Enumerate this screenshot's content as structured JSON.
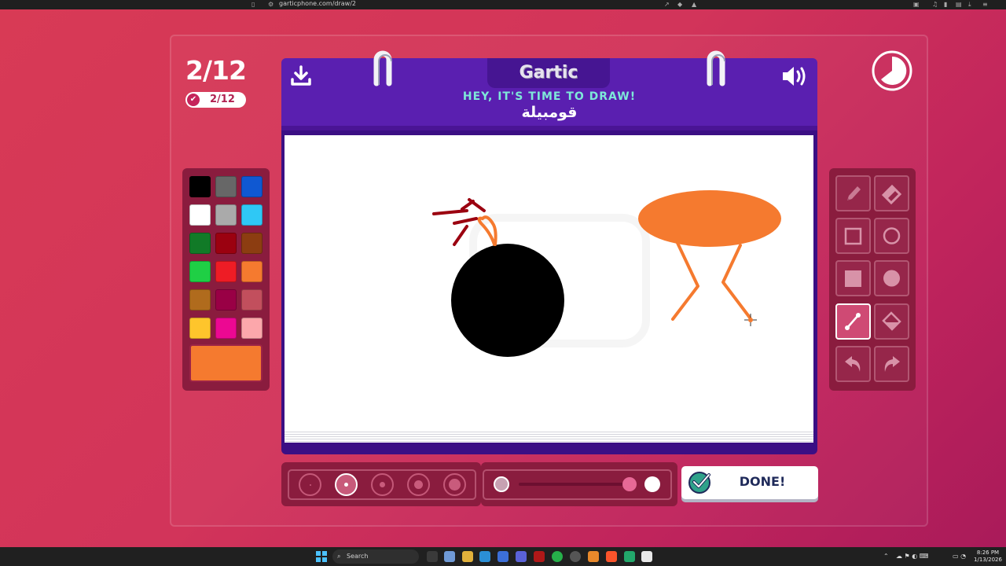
{
  "browser": {
    "url": "garticphone.com/draw/2"
  },
  "game": {
    "round_counter": "2/12",
    "round_badge": "2/12",
    "logo": "Gartic",
    "prompt": "HEY, IT'S TIME TO DRAW!",
    "word": "قومبيلة",
    "done_label": "DONE!"
  },
  "palette": {
    "colors": [
      "#000000",
      "#676767",
      "#0f58d2",
      "#ffffff",
      "#aaaaaa",
      "#2fc8f5",
      "#117a27",
      "#9b0110",
      "#8c3d11",
      "#1fcf45",
      "#ee1c25",
      "#f57a2f",
      "#b06b1d",
      "#990045",
      "#c24f5d",
      "#fec52c",
      "#ec0892",
      "#fca7ab"
    ],
    "current": "#f57a2f"
  },
  "tools": [
    {
      "name": "pencil-tool",
      "icon": "pencil-icon"
    },
    {
      "name": "eraser-tool",
      "icon": "eraser-icon"
    },
    {
      "name": "rectangle-outline-tool",
      "icon": "square-outline-icon"
    },
    {
      "name": "ellipse-outline-tool",
      "icon": "circle-outline-icon"
    },
    {
      "name": "rectangle-fill-tool",
      "icon": "square-fill-icon"
    },
    {
      "name": "ellipse-fill-tool",
      "icon": "circle-fill-icon"
    },
    {
      "name": "line-tool",
      "icon": "line-icon",
      "active": true
    },
    {
      "name": "fill-bucket-tool",
      "icon": "bucket-icon"
    },
    {
      "name": "undo-tool",
      "icon": "undo-icon"
    },
    {
      "name": "redo-tool",
      "icon": "redo-icon"
    }
  ],
  "brush_size": {
    "options": 5,
    "selected_index": 1
  },
  "opacity": {
    "value": 1.0
  },
  "taskbar": {
    "search_label": "Search",
    "time": "8:26 PM",
    "date": "1/13/2026"
  },
  "colors": {
    "header_purple": "#5a1fb0",
    "prompt_teal": "#7ee8d9",
    "panel_maroon": "#8a1c3e"
  }
}
